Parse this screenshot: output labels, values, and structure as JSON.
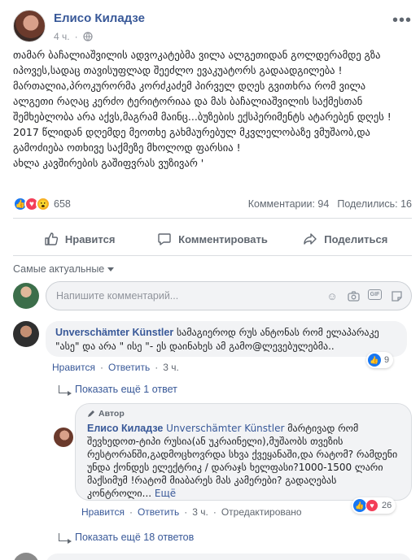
{
  "post": {
    "author": "Елисо Киладзе",
    "time": "4 ч.",
    "privacy_icon": "globe-icon",
    "text_lines": [
      "თამარ ბაჩალიაშვილის ადვოკატებმა ვილა ალგეთიდან გოლდერამდე გზა",
      "იპოვეს,სადაც თავისუფლად შეეძლო ევაკუატორს გადაადგილება !",
      "მართალია,პროკურორმა კორძკაძემ პირველ დღეს გვითხრა რომ ვილა",
      "ალგეთი რაღაც კერძო ტერიტორიაა და მას ბაჩალიაშვილის საქმესთან",
      "შემხებლობა არა აქვს,მაგრამ მაინც...ბუზების ექსპერიმენტს ატარებენ დღეს !",
      "2017 წლიდან დღემდე მეოთხე გახმაურებულ მკვლელობაზე ვმუშაობ,და",
      "გამოძიება ოთხივე საქმეზე მხოლოდ ფარსია !",
      "ახლა კავშირების გაშიფვრას ვუზივარ '"
    ]
  },
  "stats": {
    "reactions_count": "658",
    "comments": "Комментарии: 94",
    "shares": "Поделились: 16"
  },
  "actions": {
    "like": "Нравится",
    "comment": "Комментировать",
    "share": "Поделиться"
  },
  "sort": {
    "label": "Самые актуальные"
  },
  "composer": {
    "placeholder": "Напишите комментарий..."
  },
  "comment1": {
    "author": "Unverschämter Künstler",
    "text": "სამაგიეროდ რუს ანტონას რომ ელაპარაკე \"ასე\" და არა \" ისე \"- ეს დაინახეს ამ გამო@ლევებულებმა..",
    "like_link": "Нравится",
    "reply_link": "Ответить",
    "time": "3 ч.",
    "likes": "9",
    "show_more": "Показать ещё 1 ответ"
  },
  "reply1": {
    "author_tag": "Автор",
    "author": "Елисо Киладзе",
    "mention": "Unverschämter Künstler",
    "text": "მარტივად რომ შევხედოთ-ტიპი რუსია(ან უკრაინელი),მუშაობს თვეზის რესტორანში,გადმოცხოვრდა სხვა ქვეყანაში,და რატომ? რამდენი უნდა ქონდეს ელექტრიკ / დარაჯს ხელფასი?1000-1500 ლარი მაქსიმუმ !რატომ მიაბარეს მას კამერები? გადაღებას კონტროლი...",
    "see_more": "Ещё",
    "like_link": "Нравится",
    "reply_link": "Ответить",
    "time": "3 ч.",
    "edited": "Отредактировано",
    "likes": "26"
  },
  "more_replies": {
    "label": "Показать ещё 18 ответов"
  }
}
